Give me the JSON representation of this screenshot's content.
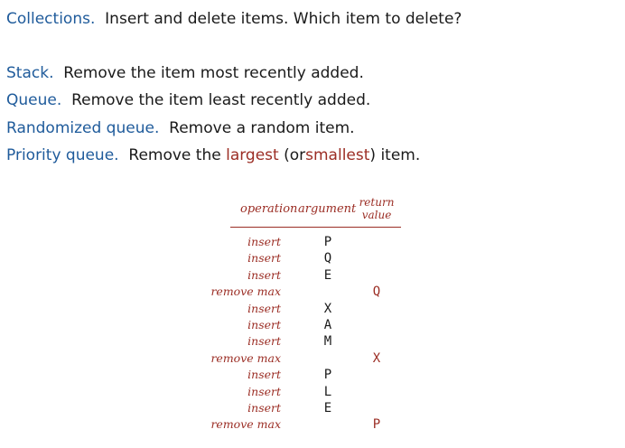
{
  "intro": {
    "term": "Collections.",
    "text": "Insert and delete items. Which item to delete?"
  },
  "definitions": [
    {
      "term": "Stack.",
      "text": "Remove the item most recently added."
    },
    {
      "term": "Queue.",
      "text": "Remove the item least recently added."
    },
    {
      "term": "Randomized queue.",
      "text": "Remove a random item."
    }
  ],
  "priority": {
    "term": "Priority queue.",
    "text_before": "Remove the",
    "largest": "largest",
    "text_mid": "(or",
    "smallest": "smallest",
    "text_after": ") item."
  },
  "table": {
    "headers": {
      "operation": "operation",
      "argument": "argument",
      "return_line1": "return",
      "return_line2": "value"
    },
    "rows": [
      {
        "operation": "insert",
        "argument": "P",
        "return": ""
      },
      {
        "operation": "insert",
        "argument": "Q",
        "return": ""
      },
      {
        "operation": "insert",
        "argument": "E",
        "return": ""
      },
      {
        "operation": "remove max",
        "argument": "",
        "return": "Q"
      },
      {
        "operation": "insert",
        "argument": "X",
        "return": ""
      },
      {
        "operation": "insert",
        "argument": "A",
        "return": ""
      },
      {
        "operation": "insert",
        "argument": "M",
        "return": ""
      },
      {
        "operation": "remove max",
        "argument": "",
        "return": "X"
      },
      {
        "operation": "insert",
        "argument": "P",
        "return": ""
      },
      {
        "operation": "insert",
        "argument": "L",
        "return": ""
      },
      {
        "operation": "insert",
        "argument": "E",
        "return": ""
      },
      {
        "operation": "remove max",
        "argument": "",
        "return": "P"
      }
    ]
  }
}
